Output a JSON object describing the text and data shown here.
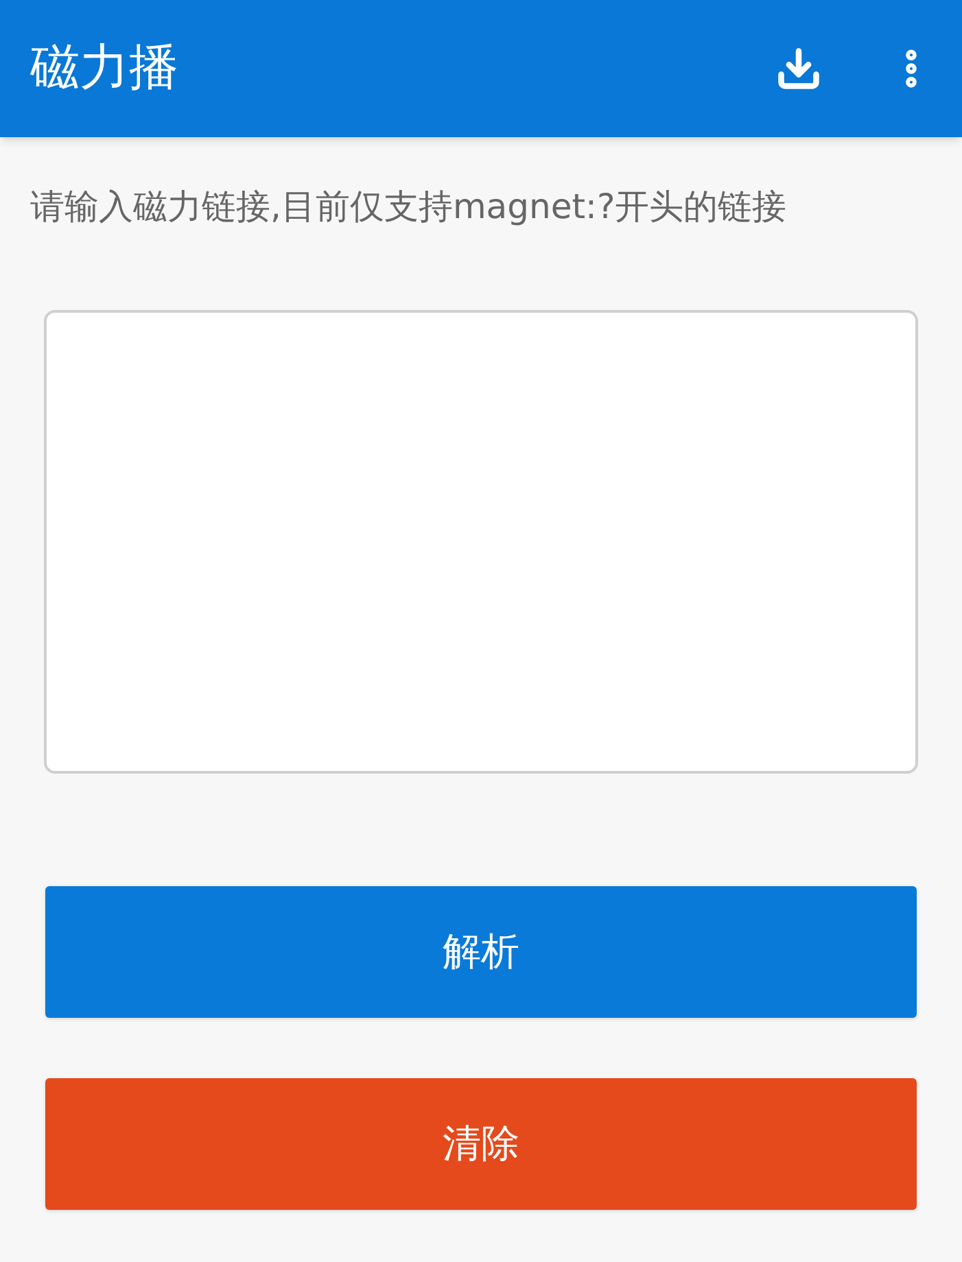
{
  "app_bar": {
    "title": "磁力播"
  },
  "hint": "请输入磁力链接,目前仅支持magnet:?开头的链接",
  "buttons": [
    {
      "label": "解析",
      "kind": "primary"
    },
    {
      "label": "清除",
      "kind": "danger"
    }
  ]
}
